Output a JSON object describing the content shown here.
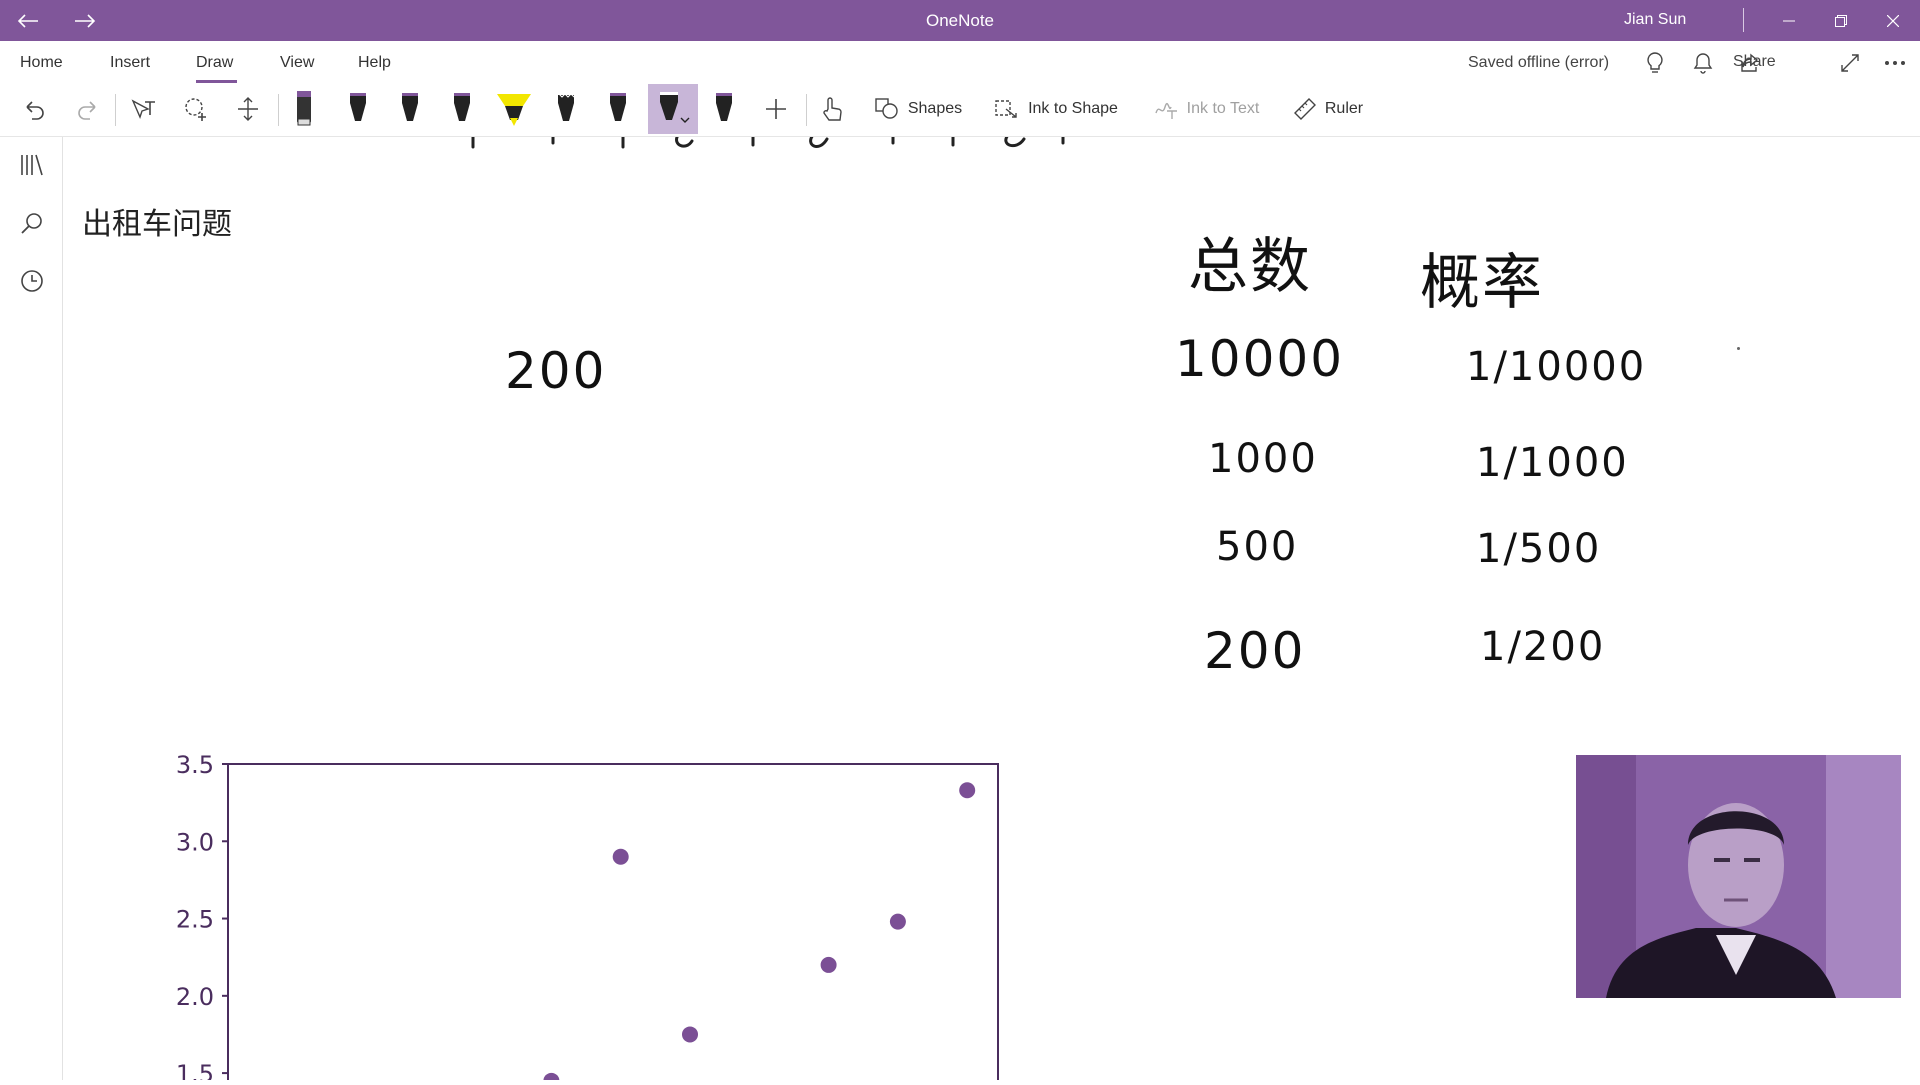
{
  "titlebar": {
    "app_title": "OneNote",
    "user": "Jian Sun"
  },
  "menu": {
    "tabs": [
      {
        "label": "Home"
      },
      {
        "label": "Insert"
      },
      {
        "label": "Draw"
      },
      {
        "label": "View"
      },
      {
        "label": "Help"
      }
    ],
    "active_tab": "Draw",
    "status": "Saved offline (error)",
    "share": "Share"
  },
  "toolbar": {
    "shapes": "Shapes",
    "ink_to_shape": "Ink to Shape",
    "ink_to_text": "Ink to Text",
    "ruler": "Ruler"
  },
  "note": {
    "typed_title": "出租车问题",
    "ink_value": "200",
    "table_headers": [
      "总数",
      "概率"
    ],
    "table_rows": [
      {
        "total": "10000",
        "prob": "1/10000"
      },
      {
        "total": "1000",
        "prob": "1/1000"
      },
      {
        "total": "500",
        "prob": "1/500"
      },
      {
        "total": "200",
        "prob": "1/200"
      }
    ]
  },
  "colors": {
    "accent": "#80569a",
    "point": "#7b4f95"
  },
  "chart_data": {
    "type": "scatter",
    "yticks": [
      "3.5",
      "3.0",
      "2.5",
      "2.0",
      "1.5"
    ],
    "ylim": [
      1.3,
      3.5
    ],
    "xlim": [
      0,
      10
    ],
    "points": [
      {
        "x": 4.2,
        "y": 1.45
      },
      {
        "x": 5.1,
        "y": 2.9
      },
      {
        "x": 6.0,
        "y": 1.75
      },
      {
        "x": 7.8,
        "y": 2.2
      },
      {
        "x": 8.7,
        "y": 2.48
      },
      {
        "x": 9.6,
        "y": 3.33
      }
    ]
  }
}
